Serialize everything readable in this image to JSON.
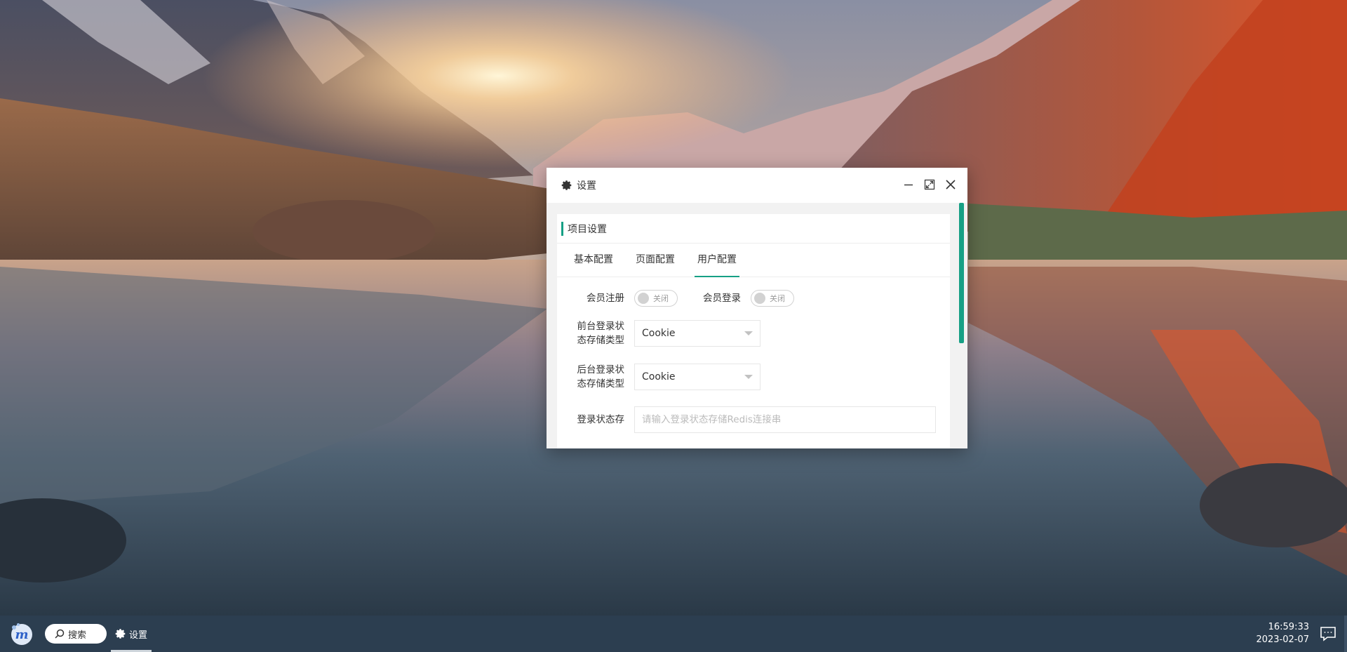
{
  "window": {
    "title": "设置",
    "icon": "gear-icon",
    "controls": [
      "minimize-icon",
      "maximize-icon",
      "close-icon"
    ]
  },
  "card": {
    "title": "项目设置"
  },
  "tabs": [
    {
      "label": "基本配置",
      "active": false
    },
    {
      "label": "页面配置",
      "active": false
    },
    {
      "label": "用户配置",
      "active": true
    }
  ],
  "form": {
    "member_register": {
      "label": "会员注册",
      "state": "关闭"
    },
    "member_login": {
      "label": "会员登录",
      "state": "关闭"
    },
    "front_login_storage": {
      "label_line1": "前台登录状",
      "label_line2": "态存储类型",
      "value": "Cookie"
    },
    "back_login_storage": {
      "label_line1": "后台登录状",
      "label_line2": "态存储类型",
      "value": "Cookie"
    },
    "login_state_redis": {
      "label": "登录状态存",
      "placeholder": "请输入登录状态存储Redis连接串"
    }
  },
  "taskbar": {
    "start_icon": "app-logo-icon",
    "search_label": "搜索",
    "task_label": "设置",
    "time": "16:59:33",
    "date": "2023-02-07",
    "notification_icon": "message-icon"
  },
  "colors": {
    "accent": "#16a085",
    "taskbar": "#2c3e50"
  }
}
